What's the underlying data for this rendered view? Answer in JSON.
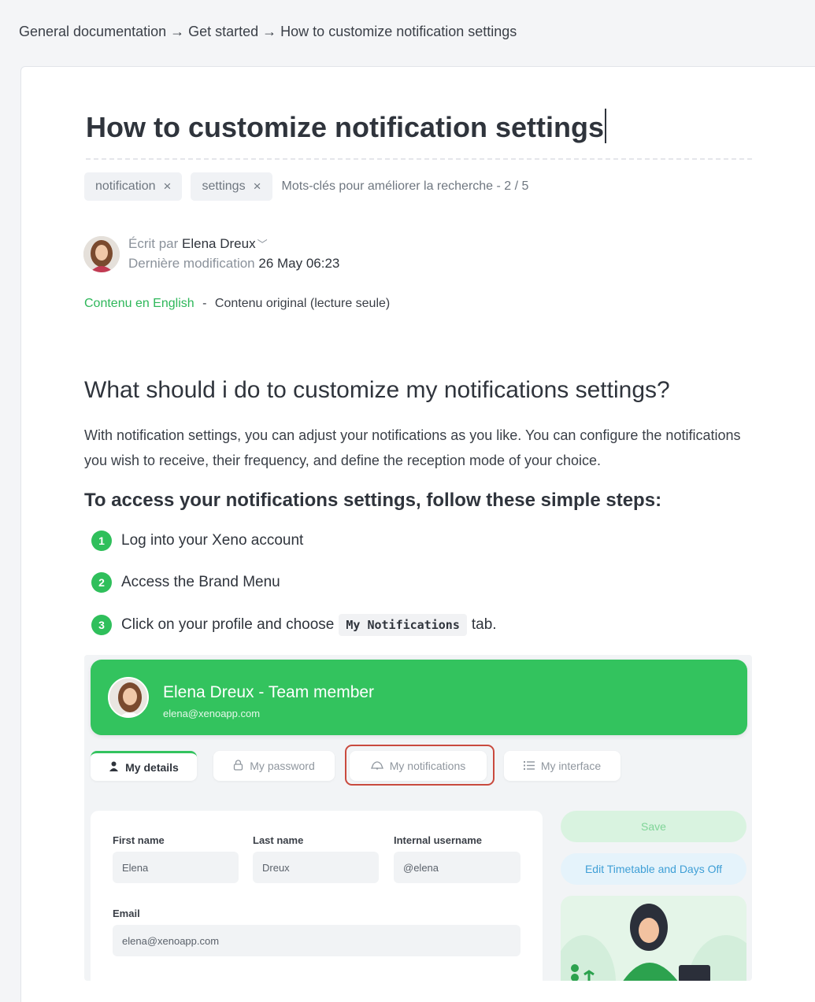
{
  "breadcrumb": {
    "items": [
      "General documentation",
      "Get started",
      "How to customize notification settings"
    ],
    "separator": "→"
  },
  "article": {
    "title": "How to customize notification settings",
    "tags": [
      {
        "label": "notification",
        "remove": "×"
      },
      {
        "label": "settings",
        "remove": "×"
      }
    ],
    "tags_hint": "Mots-clés pour améliorer la recherche - 2 / 5",
    "author": {
      "written_by_label": "Écrit par",
      "name": "Elena Dreux",
      "modified_label": "Dernière modification",
      "modified_value": "26 May 06:23"
    },
    "language": {
      "link": "Contenu en English",
      "separator": "-",
      "status": "Contenu original (lecture seule)"
    },
    "heading": "What should i do to customize my notifications settings?",
    "paragraph": "With notification settings, you can adjust your notifications as you like. You can configure the notifications you wish to receive, their frequency, and define the reception mode of your choice.",
    "subheading": "To access your notifications settings, follow these simple steps:",
    "steps": [
      {
        "num": "1",
        "text": "Log into your Xeno account"
      },
      {
        "num": "2",
        "text": "Access the Brand Menu"
      },
      {
        "num": "3",
        "text_before": "Click on your profile and choose",
        "code": "My Notifications",
        "text_after": "tab."
      }
    ]
  },
  "screenshot": {
    "banner_name": "Elena Dreux - Team member",
    "banner_email": "elena@xenoapp.com",
    "tabs": [
      {
        "label": "My details",
        "icon": "user-icon"
      },
      {
        "label": "My password",
        "icon": "lock-icon"
      },
      {
        "label": "My notifications",
        "icon": "bell-icon"
      },
      {
        "label": "My interface",
        "icon": "list-icon"
      }
    ],
    "form": {
      "first_name_label": "First name",
      "first_name_value": "Elena",
      "last_name_label": "Last name",
      "last_name_value": "Dreux",
      "username_label": "Internal username",
      "username_value": "@elena",
      "email_label": "Email",
      "email_value": "elena@xenoapp.com"
    },
    "save_label": "Save",
    "edit_label": "Edit Timetable and Days Off"
  },
  "colors": {
    "accent_green": "#33c35e",
    "highlight_red": "#c94a3e",
    "link_green": "#2eb75a"
  }
}
